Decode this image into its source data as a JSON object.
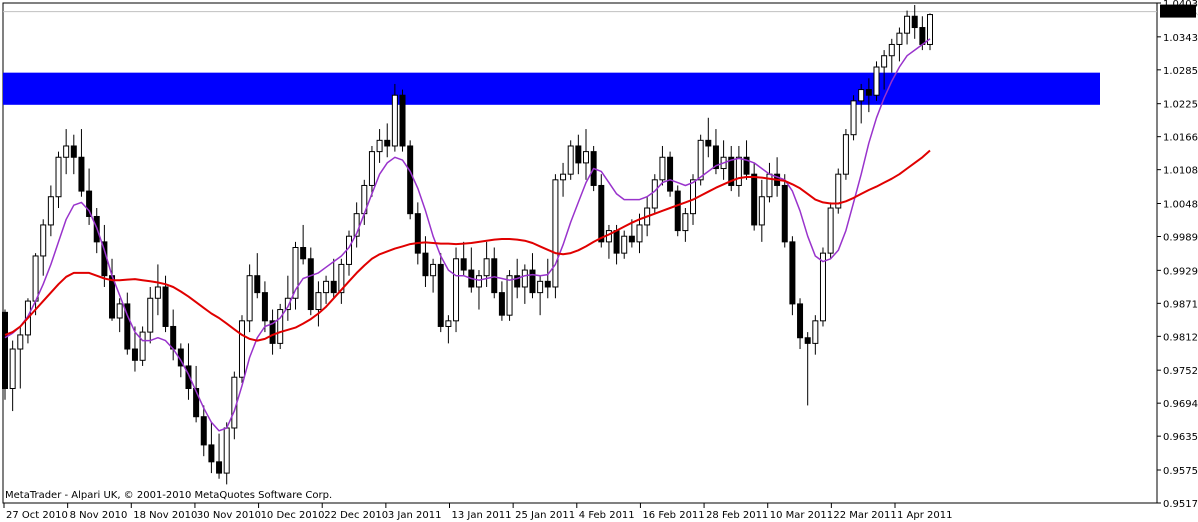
{
  "window": {
    "copyright": "MetaTrader - Alpari UK, © 2001-2010 MetaQuotes Software Corp."
  },
  "colors": {
    "background": "#ffffff",
    "zone": "#0000ff",
    "ma_fast": "#9933cc",
    "ma_slow": "#e00000",
    "candle": "#000000",
    "price_line": "#c0c0c0"
  },
  "chart_data": {
    "type": "candlestick",
    "symbol_price_current": "1.03883",
    "ylim": [
      0.9517,
      1.04035
    ],
    "y_ticks": [
      "1.04035",
      "1.03435",
      "1.02850",
      "1.02250",
      "1.01665",
      "1.01080",
      "1.00480",
      "0.99895",
      "0.99295",
      "0.98710",
      "0.98125",
      "0.97525",
      "0.96940",
      "0.96355",
      "0.95755",
      "0.95170"
    ],
    "x_ticks": [
      "27 Oct 2010",
      "8 Nov 2010",
      "18 Nov 2010",
      "30 Nov 2010",
      "10 Dec 2010",
      "22 Dec 2010",
      "3 Jan 2011",
      "13 Jan 2011",
      "25 Jan 2011",
      "4 Feb 2011",
      "16 Feb 2011",
      "28 Feb 2011",
      "10 Mar 2011",
      "22 Mar 2011",
      "1 Apr 2011"
    ],
    "zone": {
      "low": 1.0223,
      "high": 1.028,
      "label": ""
    },
    "candles": [
      [
        0.9855,
        0.986,
        0.97,
        0.972
      ],
      [
        0.972,
        0.9805,
        0.968,
        0.979
      ],
      [
        0.979,
        0.983,
        0.972,
        0.9815
      ],
      [
        0.9815,
        0.988,
        0.98,
        0.9875
      ],
      [
        0.9875,
        0.996,
        0.985,
        0.9955
      ],
      [
        0.9955,
        1.002,
        0.992,
        1.001
      ],
      [
        1.001,
        1.008,
        0.999,
        1.006
      ],
      [
        1.006,
        1.014,
        1.004,
        1.013
      ],
      [
        1.013,
        1.018,
        1.01,
        1.015
      ],
      [
        1.015,
        1.017,
        1.01,
        1.013
      ],
      [
        1.013,
        1.018,
        1.006,
        1.007
      ],
      [
        1.007,
        1.011,
        1.001,
        1.0025
      ],
      [
        1.0025,
        1.004,
        0.996,
        0.998
      ],
      [
        0.998,
        1.001,
        0.99,
        0.992
      ],
      [
        0.992,
        0.995,
        0.984,
        0.9845
      ],
      [
        0.9845,
        0.988,
        0.982,
        0.987
      ],
      [
        0.987,
        0.989,
        0.978,
        0.979
      ],
      [
        0.979,
        0.983,
        0.975,
        0.977
      ],
      [
        0.977,
        0.983,
        0.976,
        0.982
      ],
      [
        0.982,
        0.99,
        0.98,
        0.988
      ],
      [
        0.988,
        0.994,
        0.985,
        0.99
      ],
      [
        0.99,
        0.992,
        0.982,
        0.983
      ],
      [
        0.983,
        0.986,
        0.977,
        0.979
      ],
      [
        0.979,
        0.98,
        0.974,
        0.976
      ],
      [
        0.976,
        0.98,
        0.97,
        0.972
      ],
      [
        0.972,
        0.976,
        0.966,
        0.967
      ],
      [
        0.967,
        0.969,
        0.96,
        0.962
      ],
      [
        0.962,
        0.966,
        0.957,
        0.959
      ],
      [
        0.959,
        0.964,
        0.956,
        0.957
      ],
      [
        0.957,
        0.966,
        0.955,
        0.965
      ],
      [
        0.965,
        0.975,
        0.963,
        0.974
      ],
      [
        0.974,
        0.985,
        0.973,
        0.984
      ],
      [
        0.984,
        0.994,
        0.982,
        0.992
      ],
      [
        0.992,
        0.996,
        0.988,
        0.989
      ],
      [
        0.989,
        0.991,
        0.982,
        0.984
      ],
      [
        0.984,
        0.986,
        0.978,
        0.98
      ],
      [
        0.98,
        0.987,
        0.979,
        0.986
      ],
      [
        0.986,
        0.992,
        0.984,
        0.988
      ],
      [
        0.988,
        0.998,
        0.986,
        0.997
      ],
      [
        0.997,
        1.001,
        0.994,
        0.995
      ],
      [
        0.995,
        0.997,
        0.985,
        0.986
      ],
      [
        0.986,
        0.991,
        0.983,
        0.989
      ],
      [
        0.989,
        0.992,
        0.987,
        0.991
      ],
      [
        0.991,
        0.995,
        0.988,
        0.989
      ],
      [
        0.989,
        0.995,
        0.987,
        0.994
      ],
      [
        0.994,
        1.0,
        0.992,
        0.999
      ],
      [
        0.999,
        1.005,
        0.997,
        1.003
      ],
      [
        1.003,
        1.009,
        1.001,
        1.008
      ],
      [
        1.008,
        1.015,
        1.006,
        1.014
      ],
      [
        1.014,
        1.018,
        1.012,
        1.016
      ],
      [
        1.016,
        1.019,
        1.013,
        1.015
      ],
      [
        1.015,
        1.026,
        1.014,
        1.024
      ],
      [
        1.024,
        1.025,
        1.014,
        1.015
      ],
      [
        1.015,
        1.016,
        1.002,
        1.003
      ],
      [
        1.003,
        1.005,
        0.994,
        0.996
      ],
      [
        0.996,
        0.999,
        0.99,
        0.992
      ],
      [
        0.992,
        0.995,
        0.989,
        0.994
      ],
      [
        0.994,
        0.996,
        0.982,
        0.983
      ],
      [
        0.983,
        0.985,
        0.98,
        0.984
      ],
      [
        0.984,
        0.997,
        0.982,
        0.995
      ],
      [
        0.995,
        0.998,
        0.992,
        0.993
      ],
      [
        0.993,
        0.997,
        0.989,
        0.99
      ],
      [
        0.99,
        0.993,
        0.986,
        0.992
      ],
      [
        0.992,
        0.998,
        0.99,
        0.995
      ],
      [
        0.995,
        0.997,
        0.988,
        0.989
      ],
      [
        0.989,
        0.991,
        0.984,
        0.985
      ],
      [
        0.985,
        0.993,
        0.984,
        0.992
      ],
      [
        0.992,
        0.995,
        0.988,
        0.99
      ],
      [
        0.99,
        0.994,
        0.987,
        0.993
      ],
      [
        0.993,
        0.996,
        0.988,
        0.989
      ],
      [
        0.989,
        0.992,
        0.985,
        0.991
      ],
      [
        0.991,
        0.995,
        0.988,
        0.99
      ],
      [
        0.99,
        1.01,
        0.988,
        1.009
      ],
      [
        1.009,
        1.012,
        1.006,
        1.01
      ],
      [
        1.01,
        1.016,
        1.009,
        1.015
      ],
      [
        1.015,
        1.017,
        1.01,
        1.012
      ],
      [
        1.012,
        1.018,
        1.009,
        1.014
      ],
      [
        1.014,
        1.015,
        1.007,
        1.008
      ],
      [
        1.008,
        1.01,
        0.997,
        0.998
      ],
      [
        0.998,
        1.001,
        0.995,
        1.0
      ],
      [
        1.0,
        1.001,
        0.994,
        0.996
      ],
      [
        0.996,
        1.0,
        0.995,
        0.999
      ],
      [
        0.999,
        1.002,
        0.997,
        0.998
      ],
      [
        0.998,
        1.003,
        0.996,
        1.001
      ],
      [
        1.001,
        1.006,
        0.999,
        1.004
      ],
      [
        1.004,
        1.01,
        1.003,
        1.009
      ],
      [
        1.009,
        1.015,
        1.008,
        1.013
      ],
      [
        1.013,
        1.014,
        1.006,
        1.007
      ],
      [
        1.007,
        1.008,
        0.999,
        1.0
      ],
      [
        1.0,
        1.004,
        0.998,
        1.003
      ],
      [
        1.003,
        1.01,
        1.001,
        1.009
      ],
      [
        1.009,
        1.017,
        1.008,
        1.016
      ],
      [
        1.016,
        1.02,
        1.013,
        1.015
      ],
      [
        1.015,
        1.018,
        1.01,
        1.011
      ],
      [
        1.011,
        1.016,
        1.009,
        1.013
      ],
      [
        1.013,
        1.015,
        1.007,
        1.008
      ],
      [
        1.008,
        1.015,
        1.006,
        1.013
      ],
      [
        1.013,
        1.016,
        1.009,
        1.01
      ],
      [
        1.01,
        1.012,
        1.0,
        1.001
      ],
      [
        1.001,
        1.009,
        0.998,
        1.006
      ],
      [
        1.006,
        1.012,
        1.005,
        1.01
      ],
      [
        1.01,
        1.013,
        1.006,
        1.008
      ],
      [
        1.008,
        1.01,
        0.997,
        0.998
      ],
      [
        0.998,
        0.999,
        0.985,
        0.987
      ],
      [
        0.987,
        0.988,
        0.979,
        0.981
      ],
      [
        0.981,
        0.982,
        0.969,
        0.98
      ],
      [
        0.98,
        0.985,
        0.978,
        0.984
      ],
      [
        0.984,
        0.997,
        0.983,
        0.996
      ],
      [
        0.996,
        1.005,
        0.995,
        1.004
      ],
      [
        1.004,
        1.011,
        1.003,
        1.01
      ],
      [
        1.01,
        1.018,
        1.009,
        1.017
      ],
      [
        1.017,
        1.024,
        1.016,
        1.023
      ],
      [
        1.023,
        1.026,
        1.019,
        1.025
      ],
      [
        1.025,
        1.027,
        1.021,
        1.024
      ],
      [
        1.024,
        1.03,
        1.023,
        1.029
      ],
      [
        1.029,
        1.032,
        1.025,
        1.031
      ],
      [
        1.031,
        1.034,
        1.028,
        1.033
      ],
      [
        1.033,
        1.036,
        1.03,
        1.035
      ],
      [
        1.035,
        1.039,
        1.033,
        1.038
      ],
      [
        1.038,
        1.04,
        1.034,
        1.036
      ],
      [
        1.036,
        1.038,
        1.032,
        1.033
      ],
      [
        1.033,
        1.0385,
        1.032,
        1.0383
      ]
    ],
    "series": [
      {
        "values": [
          0.981,
          0.9818,
          0.983,
          0.9848,
          0.9875,
          0.9905,
          0.994,
          0.998,
          1.002,
          1.0045,
          1.005,
          1.0035,
          1.0005,
          0.9965,
          0.992,
          0.9885,
          0.985,
          0.982,
          0.9805,
          0.9805,
          0.981,
          0.9805,
          0.979,
          0.977,
          0.9745,
          0.9715,
          0.9685,
          0.966,
          0.9645,
          0.965,
          0.968,
          0.9725,
          0.9775,
          0.981,
          0.983,
          0.9835,
          0.9845,
          0.9865,
          0.9895,
          0.9915,
          0.992,
          0.9925,
          0.9935,
          0.9945,
          0.9955,
          0.997,
          0.9995,
          1.003,
          1.0065,
          1.01,
          1.012,
          1.013,
          1.0125,
          1.0105,
          1.0075,
          1.0035,
          0.999,
          0.9955,
          0.993,
          0.992,
          0.992,
          0.9915,
          0.9912,
          0.9915,
          0.9918,
          0.9915,
          0.9912,
          0.9915,
          0.992,
          0.9922,
          0.992,
          0.9922,
          0.994,
          0.9975,
          1.0015,
          1.005,
          1.0085,
          1.011,
          1.0105,
          1.0085,
          1.0065,
          1.0055,
          1.0055,
          1.0055,
          1.006,
          1.007,
          1.0085,
          1.009,
          1.0085,
          1.008,
          1.0085,
          1.0095,
          1.0105,
          1.0115,
          1.012,
          1.0125,
          1.0128,
          1.0125,
          1.012,
          1.011,
          1.01,
          1.0095,
          1.009,
          1.007,
          1.0035,
          0.999,
          0.9955,
          0.9945,
          0.995,
          0.9965,
          1.0,
          1.005,
          1.01,
          1.0155,
          1.02,
          1.0235,
          1.0265,
          1.029,
          1.031,
          1.032,
          1.033,
          1.034
        ]
      },
      {
        "values": [
          0.9815,
          0.982,
          0.983,
          0.9845,
          0.986,
          0.9875,
          0.989,
          0.9905,
          0.9918,
          0.9925,
          0.9925,
          0.9925,
          0.992,
          0.9915,
          0.9912,
          0.9912,
          0.9913,
          0.9914,
          0.9912,
          0.991,
          0.9908,
          0.9905,
          0.99,
          0.9892,
          0.9883,
          0.9873,
          0.9863,
          0.9853,
          0.9845,
          0.9835,
          0.9825,
          0.9815,
          0.9808,
          0.9805,
          0.9808,
          0.9815,
          0.982,
          0.9824,
          0.9828,
          0.9835,
          0.9843,
          0.9853,
          0.9865,
          0.988,
          0.9895,
          0.991,
          0.9925,
          0.9938,
          0.995,
          0.9958,
          0.9963,
          0.9968,
          0.9972,
          0.9976,
          0.9978,
          0.9979,
          0.9978,
          0.9977,
          0.9977,
          0.9976,
          0.9977,
          0.9978,
          0.998,
          0.9982,
          0.9984,
          0.9985,
          0.9985,
          0.9984,
          0.9982,
          0.9978,
          0.9972,
          0.9966,
          0.996,
          0.9958,
          0.996,
          0.9965,
          0.9972,
          0.998,
          0.9987,
          0.9993,
          1.0,
          1.0007,
          1.0014,
          1.002,
          1.0025,
          1.003,
          1.0035,
          1.004,
          1.0045,
          1.005,
          1.0055,
          1.0062,
          1.0069,
          1.0076,
          1.0082,
          1.0088,
          1.0093,
          1.0095,
          1.0095,
          1.0094,
          1.0092,
          1.009,
          1.0088,
          1.0082,
          1.0075,
          1.0065,
          1.0055,
          1.005,
          1.0048,
          1.0048,
          1.0052,
          1.0058,
          1.0065,
          1.0072,
          1.0078,
          1.0085,
          1.0092,
          1.01,
          1.011,
          1.012,
          1.013,
          1.0142
        ]
      }
    ]
  }
}
